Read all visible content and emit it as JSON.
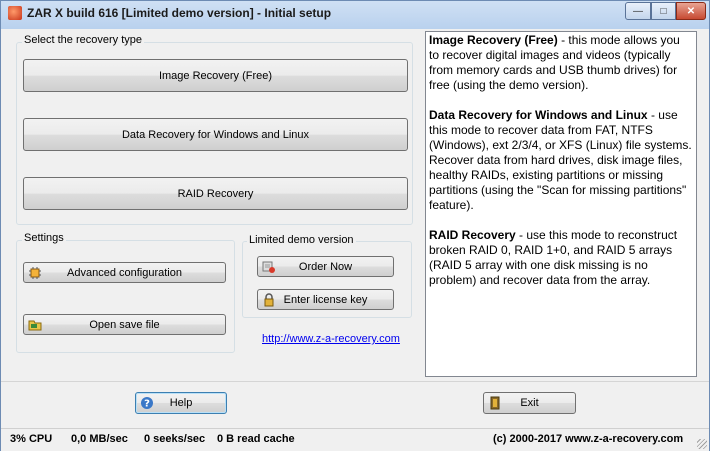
{
  "window": {
    "title": "ZAR X build 616 [Limited demo version] - Initial setup",
    "minimize": "—",
    "maximize": "□",
    "close": "✕"
  },
  "recovery_type": {
    "label": "Select the recovery type",
    "buttons": [
      "Image Recovery (Free)",
      "Data Recovery for Windows and Linux",
      "RAID Recovery"
    ]
  },
  "settings": {
    "label": "Settings",
    "advanced_label": "Advanced configuration",
    "open_save_label": "Open save file"
  },
  "demo": {
    "label": "Limited demo version",
    "order_label": "Order Now",
    "license_label": "Enter license key",
    "link": "http://www.z-a-recovery.com"
  },
  "description": [
    {
      "title": "Image Recovery (Free)",
      "text": " - this mode allows you to recover digital images and videos (typically from memory cards and USB thumb drives) for free (using the demo version)."
    },
    {
      "title": "Data Recovery for Windows and Linux",
      "text": " - use this mode to recover data from FAT, NTFS (Windows), ext 2/3/4, or XFS (Linux) file systems. Recover data from hard drives, disk image files, healthy RAIDs, existing partitions or missing partitions (using the \"Scan for missing partitions\" feature)."
    },
    {
      "title": "RAID Recovery",
      "text": " - use this mode to reconstruct broken RAID 0, RAID 1+0, and RAID 5 arrays (RAID 5 array with one disk missing is no problem) and recover data from the array."
    }
  ],
  "bottom": {
    "help_label": "Help",
    "exit_label": "Exit"
  },
  "status": {
    "cpu": "3% CPU",
    "rate": "0,0 MB/sec",
    "seeks": "0 seeks/sec",
    "read": "0 B read cache",
    "copyright": "(c) 2000-2017 www.z-a-recovery.com"
  }
}
